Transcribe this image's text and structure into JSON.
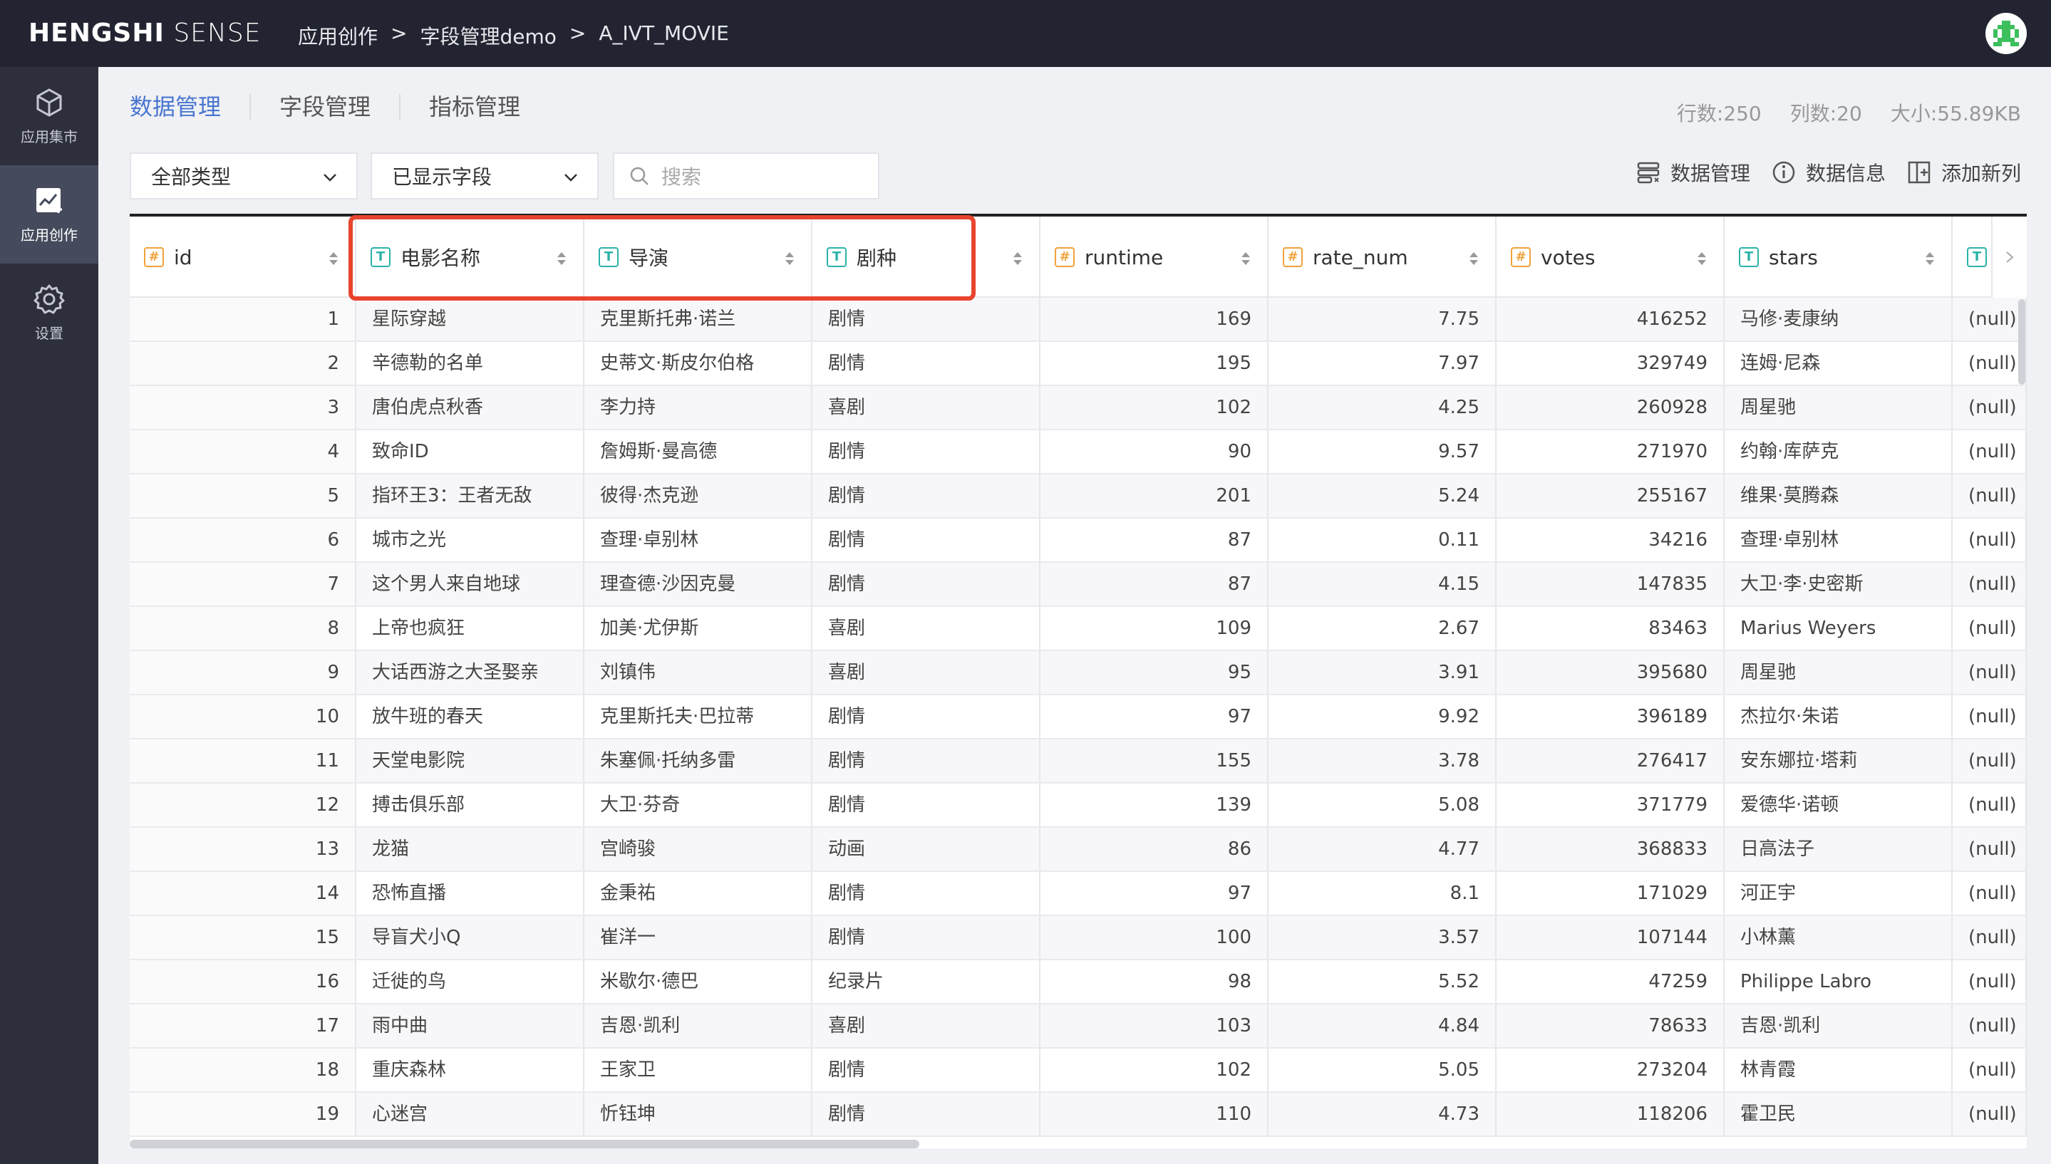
{
  "brand": {
    "bold": "HENGSHI",
    "light": "SENSE"
  },
  "breadcrumb": [
    "应用创作",
    ">",
    "字段管理demo",
    ">",
    "A_IVT_MOVIE"
  ],
  "sidebar": {
    "items": [
      {
        "label": "应用集市",
        "icon": "cube-icon"
      },
      {
        "label": "应用创作",
        "icon": "chart-edit-icon"
      },
      {
        "label": "设置",
        "icon": "gear-icon"
      }
    ]
  },
  "tabs": [
    "数据管理",
    "字段管理",
    "指标管理"
  ],
  "stats": {
    "rows": "行数:250",
    "cols": "列数:20",
    "size": "大小:55.89KB"
  },
  "filters": {
    "type": "全部类型",
    "shown": "已显示字段",
    "search_placeholder": "搜索"
  },
  "toolbar": {
    "data_manage": "数据管理",
    "data_info": "数据信息",
    "add_column": "添加新列"
  },
  "colors": {
    "accent": "#4a76d1",
    "topbar": "#222531",
    "sidebar": "#2d303c",
    "highlight": "#e8442e",
    "num_type": "#f0a23a",
    "text_type": "#2bb3a8"
  },
  "columns": [
    {
      "name": "id",
      "type": "#",
      "num": true
    },
    {
      "name": "电影名称",
      "type": "T",
      "num": false
    },
    {
      "name": "导演",
      "type": "T",
      "num": false
    },
    {
      "name": "剧种",
      "type": "T",
      "num": false
    },
    {
      "name": "runtime",
      "type": "#",
      "num": true
    },
    {
      "name": "rate_num",
      "type": "#",
      "num": true
    },
    {
      "name": "votes",
      "type": "#",
      "num": true
    },
    {
      "name": "stars",
      "type": "T",
      "num": false
    },
    {
      "name": "",
      "type": "T",
      "num": false
    }
  ],
  "rows": [
    [
      "1",
      "星际穿越",
      "克里斯托弗·诺兰",
      "剧情",
      "169",
      "7.75",
      "416252",
      "马修·麦康纳",
      "(null)"
    ],
    [
      "2",
      "辛德勒的名单",
      "史蒂文·斯皮尔伯格",
      "剧情",
      "195",
      "7.97",
      "329749",
      "连姆·尼森",
      "(null)"
    ],
    [
      "3",
      "唐伯虎点秋香",
      "李力持",
      "喜剧",
      "102",
      "4.25",
      "260928",
      "周星驰",
      "(null)"
    ],
    [
      "4",
      "致命ID",
      "詹姆斯·曼高德",
      "剧情",
      "90",
      "9.57",
      "271970",
      "约翰·库萨克",
      "(null)"
    ],
    [
      "5",
      "指环王3：王者无敌",
      "彼得·杰克逊",
      "剧情",
      "201",
      "5.24",
      "255167",
      "维果·莫腾森",
      "(null)"
    ],
    [
      "6",
      "城市之光",
      "查理·卓别林",
      "剧情",
      "87",
      "0.11",
      "34216",
      "查理·卓别林",
      "(null)"
    ],
    [
      "7",
      "这个男人来自地球",
      "理查德·沙因克曼",
      "剧情",
      "87",
      "4.15",
      "147835",
      "大卫·李·史密斯",
      "(null)"
    ],
    [
      "8",
      "上帝也疯狂",
      "加美·尤伊斯",
      "喜剧",
      "109",
      "2.67",
      "83463",
      "Marius Weyers",
      "(null)"
    ],
    [
      "9",
      "大话西游之大圣娶亲",
      "刘镇伟",
      "喜剧",
      "95",
      "3.91",
      "395680",
      "周星驰",
      "(null)"
    ],
    [
      "10",
      "放牛班的春天",
      "克里斯托夫·巴拉蒂",
      "剧情",
      "97",
      "9.92",
      "396189",
      "杰拉尔·朱诺",
      "(null)"
    ],
    [
      "11",
      "天堂电影院",
      "朱塞佩·托纳多雷",
      "剧情",
      "155",
      "3.78",
      "276417",
      "安东娜拉·塔莉",
      "(null)"
    ],
    [
      "12",
      "搏击俱乐部",
      "大卫·芬奇",
      "剧情",
      "139",
      "5.08",
      "371779",
      "爱德华·诺顿",
      "(null)"
    ],
    [
      "13",
      "龙猫",
      "宫崎骏",
      "动画",
      "86",
      "4.77",
      "368833",
      "日高法子",
      "(null)"
    ],
    [
      "14",
      "恐怖直播",
      "金秉祐",
      "剧情",
      "97",
      "8.1",
      "171029",
      "河正宇",
      "(null)"
    ],
    [
      "15",
      "导盲犬小Q",
      "崔洋一",
      "剧情",
      "100",
      "3.57",
      "107144",
      "小林薰",
      "(null)"
    ],
    [
      "16",
      "迁徙的鸟",
      "米歇尔·德巴",
      "纪录片",
      "98",
      "5.52",
      "47259",
      "Philippe Labro",
      "(null)"
    ],
    [
      "17",
      "雨中曲",
      "吉恩·凯利",
      "喜剧",
      "103",
      "4.84",
      "78633",
      "吉恩·凯利",
      "(null)"
    ],
    [
      "18",
      "重庆森林",
      "王家卫",
      "剧情",
      "102",
      "5.05",
      "273204",
      "林青霞",
      "(null)"
    ],
    [
      "19",
      "心迷宫",
      "忻钰坤",
      "剧情",
      "110",
      "4.73",
      "118206",
      "霍卫民",
      "(null)"
    ]
  ]
}
